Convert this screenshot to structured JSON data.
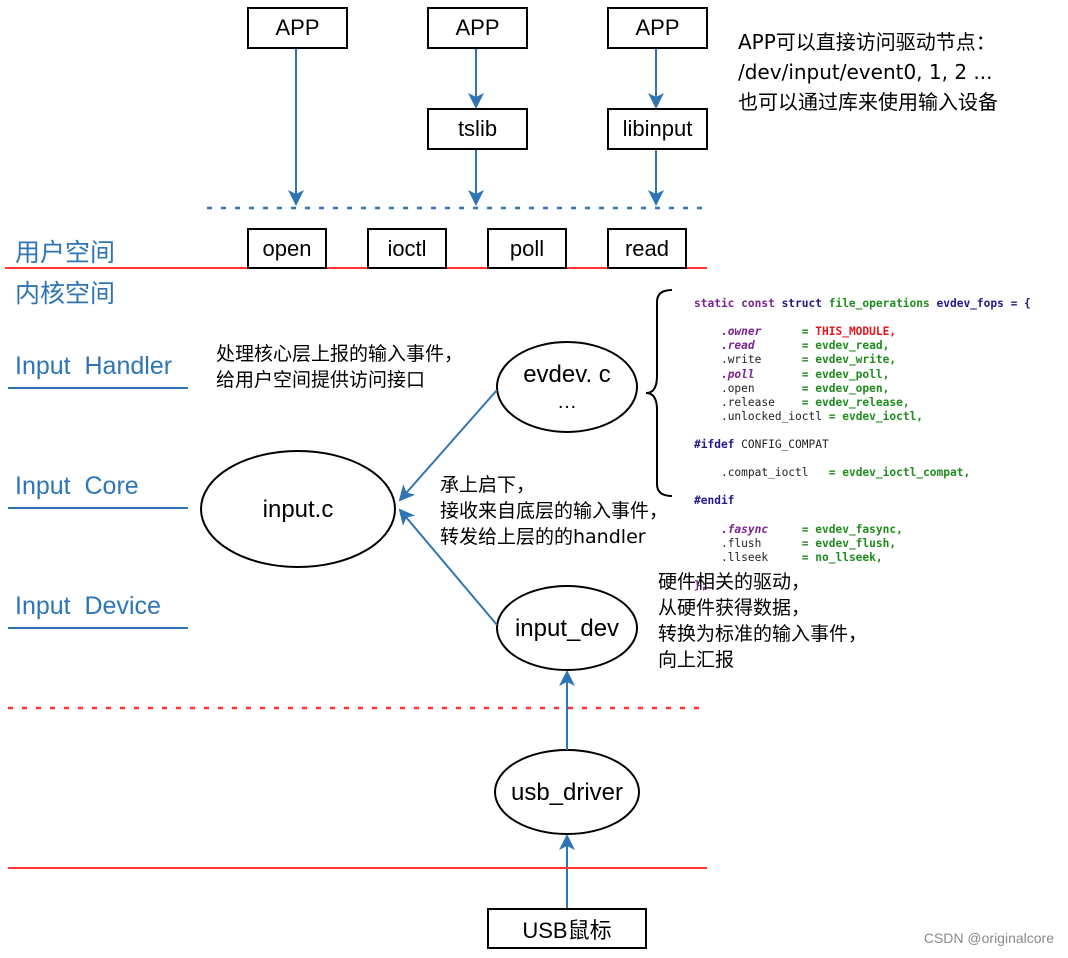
{
  "user_space": {
    "label": "用户空间",
    "apps": [
      "APP",
      "APP",
      "APP"
    ],
    "libraries": [
      "tslib",
      "libinput"
    ],
    "syscalls": [
      "open",
      "ioctl",
      "poll",
      "read"
    ],
    "app_note": [
      "APP可以直接访问驱动节点：",
      "/dev/input/event0, 1, 2 ...",
      "也可以通过库来使用输入设备"
    ]
  },
  "kernel_space": {
    "label": "内核空间",
    "layers": {
      "handler": "Input  Handler",
      "core": "Input  Core",
      "device": "Input  Device"
    },
    "nodes": {
      "evdev": "evdev. c",
      "evdev_more": "…",
      "input_c": "input.c",
      "input_dev": "input_dev",
      "usb_driver": "usb_driver"
    },
    "notes": {
      "handler": [
        "处理核心层上报的输入事件，",
        "给用户空间提供访问接口"
      ],
      "core": [
        "承上启下，",
        "接收来自底层的输入事件，",
        "转发给上层的的handler"
      ],
      "device": [
        "硬件相关的驱动，",
        "从硬件获得数据，",
        "转换为标准的输入事件，",
        "向上汇报"
      ]
    }
  },
  "hardware": {
    "device": "USB鼠标"
  },
  "code_snippet": {
    "header": [
      "static const ",
      "struct",
      " file_operations ",
      "evdev_fops = {"
    ],
    "fields": [
      {
        "name": ".owner",
        "value": "THIS_MODULE,",
        "italic": true,
        "red": true,
        "pad": "      "
      },
      {
        "name": ".read",
        "value": "evdev_read,",
        "italic": true,
        "red": false,
        "pad": "       "
      },
      {
        "name": ".write",
        "value": "evdev_write,",
        "italic": false,
        "red": false,
        "pad": "      "
      },
      {
        "name": ".poll",
        "value": "evdev_poll,",
        "italic": true,
        "red": false,
        "pad": "       "
      },
      {
        "name": ".open",
        "value": "evdev_open,",
        "italic": false,
        "red": false,
        "pad": "       "
      },
      {
        "name": ".release",
        "value": "evdev_release,",
        "italic": false,
        "red": false,
        "pad": "    "
      },
      {
        "name": ".unlocked_ioctl",
        "value": "evdev_ioctl,",
        "italic": false,
        "red": false,
        "pad": " "
      }
    ],
    "ifdef": "#ifdef",
    "ifdef_sym": " CONFIG_COMPAT",
    "compat_field": {
      "name": ".compat_ioctl",
      "value": "evdev_ioctl_compat,",
      "pad": "   "
    },
    "endif": "#endif",
    "fields2": [
      {
        "name": ".fasync",
        "value": "evdev_fasync,",
        "italic": true,
        "pad": "     "
      },
      {
        "name": ".flush",
        "value": "evdev_flush,",
        "italic": false,
        "pad": "      "
      },
      {
        "name": ".llseek",
        "value": "no_llseek,",
        "italic": false,
        "pad": "     "
      }
    ],
    "closing": "};"
  },
  "colors": {
    "arrow": "#2e75b6",
    "boundary": "#ff3333",
    "layer_text": "#2e75b6"
  },
  "watermark": "CSDN @originalcore"
}
